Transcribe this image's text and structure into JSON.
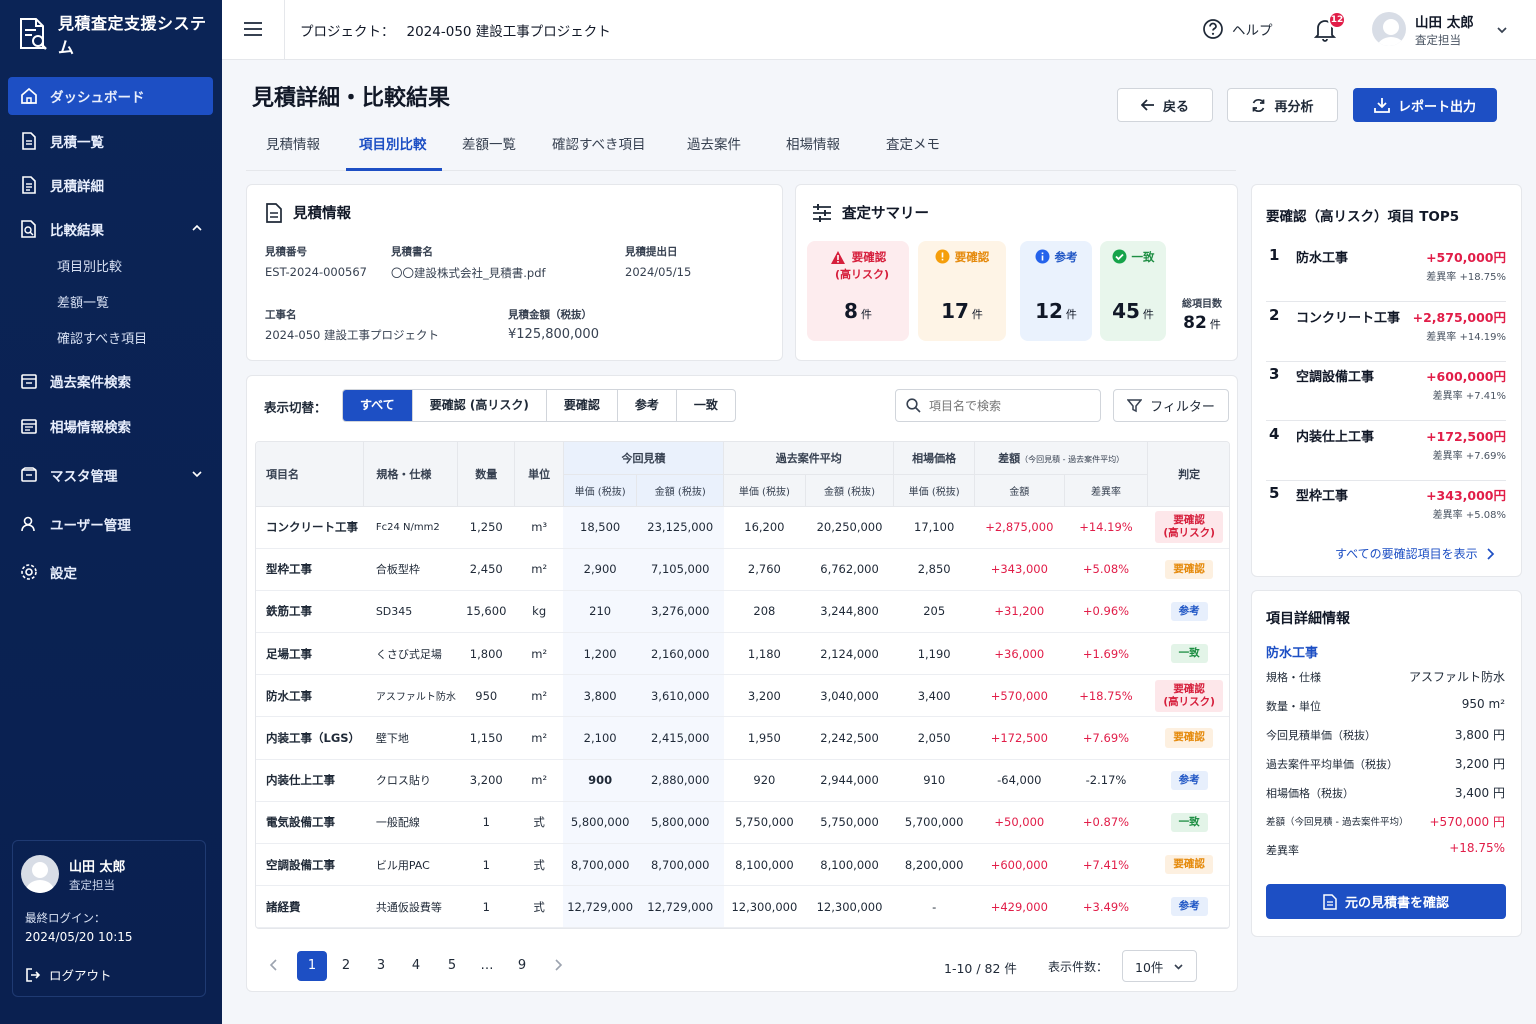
{
  "app": {
    "title": "見積査定支援システム"
  },
  "sidebar": {
    "items": [
      {
        "label": "ダッシュボード"
      },
      {
        "label": "見積一覧"
      },
      {
        "label": "見積詳細"
      },
      {
        "label": "比較結果"
      },
      {
        "label": "過去案件検索"
      },
      {
        "label": "相場情報検索"
      },
      {
        "label": "マスタ管理"
      },
      {
        "label": "ユーザー管理"
      },
      {
        "label": "設定"
      }
    ],
    "sub_items": [
      {
        "label": "項目別比較"
      },
      {
        "label": "差額一覧"
      },
      {
        "label": "確認すべき項目"
      }
    ],
    "user": {
      "name": "山田 太郎",
      "role": "査定担当",
      "last_login_label": "最終ログイン：",
      "last_login": "2024/05/20 10:15",
      "logout": "ログアウト"
    }
  },
  "header": {
    "project_label": "プロジェクト：",
    "project_name": "2024-050 建設工事プロジェクト",
    "help": "ヘルプ",
    "notifications": "12",
    "user_name": "山田 太郎",
    "user_role": "査定担当"
  },
  "page": {
    "title": "見積詳細・比較結果",
    "back": "戻る",
    "reanalyze": "再分析",
    "export": "レポート出力",
    "tabs": [
      {
        "label": "見積情報"
      },
      {
        "label": "項目別比較"
      },
      {
        "label": "差額一覧"
      },
      {
        "label": "確認すべき項目"
      },
      {
        "label": "過去案件"
      },
      {
        "label": "相場情報"
      },
      {
        "label": "査定メモ"
      }
    ]
  },
  "estimate_info": {
    "title": "見積情報",
    "no_label": "見積番号",
    "no": "EST-2024-000567",
    "name_label": "見積書名",
    "name": "〇〇建設株式会社_見積書.pdf",
    "date_label": "見積提出日",
    "date": "2024/05/15",
    "project_label": "工事名",
    "project": "2024-050 建設工事プロジェクト",
    "amount_label": "見積金額（税抜）",
    "amount": "¥125,800,000"
  },
  "summary": {
    "title": "査定サマリー",
    "high": {
      "label1": "要確認",
      "label2": "(高リスク)",
      "count": "8",
      "unit": "件"
    },
    "check": {
      "label": "要確認",
      "count": "17",
      "unit": "件"
    },
    "ref": {
      "label": "参考",
      "count": "12",
      "unit": "件"
    },
    "match": {
      "label": "一致",
      "count": "45",
      "unit": "件"
    },
    "total": {
      "label": "総項目数",
      "count": "82",
      "unit": "件"
    }
  },
  "filter": {
    "label": "表示切替：",
    "options": [
      {
        "label": "すべて"
      },
      {
        "label": "要確認 (高リスク)"
      },
      {
        "label": "要確認"
      },
      {
        "label": "参考"
      },
      {
        "label": "一致"
      }
    ],
    "search_placeholder": "項目名で検索",
    "filter_button": "フィルター"
  },
  "table": {
    "headers": {
      "item": "項目名",
      "spec": "規格・仕様",
      "qty": "数量",
      "unit": "単位",
      "current": "今回見積",
      "past": "過去案件平均",
      "market": "相場価格",
      "diff": "差額",
      "diff_note": "（今回見積 - 過去案件平均）",
      "judge": "判定",
      "unit_price": "単価 (税抜)",
      "amount": "金額 (税抜)",
      "diff_amount": "金額",
      "diff_rate": "差異率"
    },
    "rows": [
      {
        "item": "コンクリート工事",
        "spec": "Fc24 N/mm2",
        "qty": "1,250",
        "unit": "m³",
        "cur_unit": "18,500",
        "cur_amt": "23,125,000",
        "past_unit": "16,200",
        "past_amt": "20,250,000",
        "market": "17,100",
        "diff": "+2,875,000",
        "rate": "+14.19%",
        "judge": "要確認\n(高リスク)",
        "jtype": "hr"
      },
      {
        "item": "型枠工事",
        "spec": "合板型枠",
        "qty": "2,450",
        "unit": "m²",
        "cur_unit": "2,900",
        "cur_amt": "7,105,000",
        "past_unit": "2,760",
        "past_amt": "6,762,000",
        "market": "2,850",
        "diff": "+343,000",
        "rate": "+5.08%",
        "judge": "要確認",
        "jtype": "md"
      },
      {
        "item": "鉄筋工事",
        "spec": "SD345",
        "qty": "15,600",
        "unit": "kg",
        "cur_unit": "210",
        "cur_amt": "3,276,000",
        "past_unit": "208",
        "past_amt": "3,244,800",
        "market": "205",
        "diff": "+31,200",
        "rate": "+0.96%",
        "judge": "参考",
        "jtype": "rf"
      },
      {
        "item": "足場工事",
        "spec": "くさび式足場",
        "qty": "1,800",
        "unit": "m²",
        "cur_unit": "1,200",
        "cur_amt": "2,160,000",
        "past_unit": "1,180",
        "past_amt": "2,124,000",
        "market": "1,190",
        "diff": "+36,000",
        "rate": "+1.69%",
        "judge": "一致",
        "jtype": "ok"
      },
      {
        "item": "防水工事",
        "spec": "アスファルト防水",
        "qty": "950",
        "unit": "m²",
        "cur_unit": "3,800",
        "cur_amt": "3,610,000",
        "past_unit": "3,200",
        "past_amt": "3,040,000",
        "market": "3,400",
        "diff": "+570,000",
        "rate": "+18.75%",
        "judge": "要確認\n(高リスク)",
        "jtype": "hr"
      },
      {
        "item": "内装工事（LGS）",
        "spec": "壁下地",
        "qty": "1,150",
        "unit": "m²",
        "cur_unit": "2,100",
        "cur_amt": "2,415,000",
        "past_unit": "1,950",
        "past_amt": "2,242,500",
        "market": "2,050",
        "diff": "+172,500",
        "rate": "+7.69%",
        "judge": "要確認",
        "jtype": "md"
      },
      {
        "item": "内装仕上工事",
        "spec": "クロス貼り",
        "qty": "3,200",
        "unit": "m²",
        "cur_unit": "900",
        "cur_amt": "2,880,000",
        "past_unit": "920",
        "past_amt": "2,944,000",
        "market": "910",
        "diff": "-64,000",
        "rate": "-2.17%",
        "judge": "参考",
        "jtype": "rf"
      },
      {
        "item": "電気設備工事",
        "spec": "一般配線",
        "qty": "1",
        "unit": "式",
        "cur_unit": "5,800,000",
        "cur_amt": "5,800,000",
        "past_unit": "5,750,000",
        "past_amt": "5,750,000",
        "market": "5,700,000",
        "diff": "+50,000",
        "rate": "+0.87%",
        "judge": "一致",
        "jtype": "ok"
      },
      {
        "item": "空調設備工事",
        "spec": "ビル用PAC",
        "qty": "1",
        "unit": "式",
        "cur_unit": "8,700,000",
        "cur_amt": "8,700,000",
        "past_unit": "8,100,000",
        "past_amt": "8,100,000",
        "market": "8,200,000",
        "diff": "+600,000",
        "rate": "+7.41%",
        "judge": "要確認",
        "jtype": "md"
      },
      {
        "item": "諸経費",
        "spec": "共通仮設費等",
        "qty": "1",
        "unit": "式",
        "cur_unit": "12,729,000",
        "cur_amt": "12,729,000",
        "past_unit": "12,300,000",
        "past_amt": "12,300,000",
        "market": "-",
        "diff": "+429,000",
        "rate": "+3.49%",
        "judge": "参考",
        "jtype": "rf"
      }
    ]
  },
  "pagination": {
    "pages": [
      "1",
      "2",
      "3",
      "4",
      "5",
      "…",
      "9"
    ],
    "range": "1-10 / 82 件",
    "per_page_label": "表示件数：",
    "per_page": "10件"
  },
  "top5": {
    "title": "要確認（高リスク）項目 TOP5",
    "rate_label": "差異率",
    "items": [
      {
        "rank": "1",
        "name": "防水工事",
        "amount": "+570,000円",
        "rate": "+18.75%"
      },
      {
        "rank": "2",
        "name": "コンクリート工事",
        "amount": "+2,875,000円",
        "rate": "+14.19%"
      },
      {
        "rank": "3",
        "name": "空調設備工事",
        "amount": "+600,000円",
        "rate": "+7.41%"
      },
      {
        "rank": "4",
        "name": "内装仕上工事",
        "amount": "+172,500円",
        "rate": "+7.69%"
      },
      {
        "rank": "5",
        "name": "型枠工事",
        "amount": "+343,000円",
        "rate": "+5.08%"
      }
    ],
    "show_all": "すべての要確認項目を表示"
  },
  "detail": {
    "title": "項目詳細情報",
    "item": "防水工事",
    "spec_label": "規格・仕様",
    "spec": "アスファルト防水",
    "qty_label": "数量・単位",
    "qty": "950 m²",
    "cur_label": "今回見積単価（税抜）",
    "cur": "3,800 円",
    "past_label": "過去案件平均単価（税抜）",
    "past": "3,200 円",
    "market_label": "相場価格（税抜）",
    "market": "3,400 円",
    "diff_label": "差額（今回見積 - 過去案件平均）",
    "diff": "+570,000 円",
    "rate_label": "差異率",
    "rate": "+18.75%",
    "button": "元の見積書を確認"
  },
  "colors": {
    "sidebar": "#0b2456",
    "accent": "#1d4fc4",
    "risk": "#e11d48",
    "warn": "#e58a0c",
    "ok": "#1e8e43"
  }
}
